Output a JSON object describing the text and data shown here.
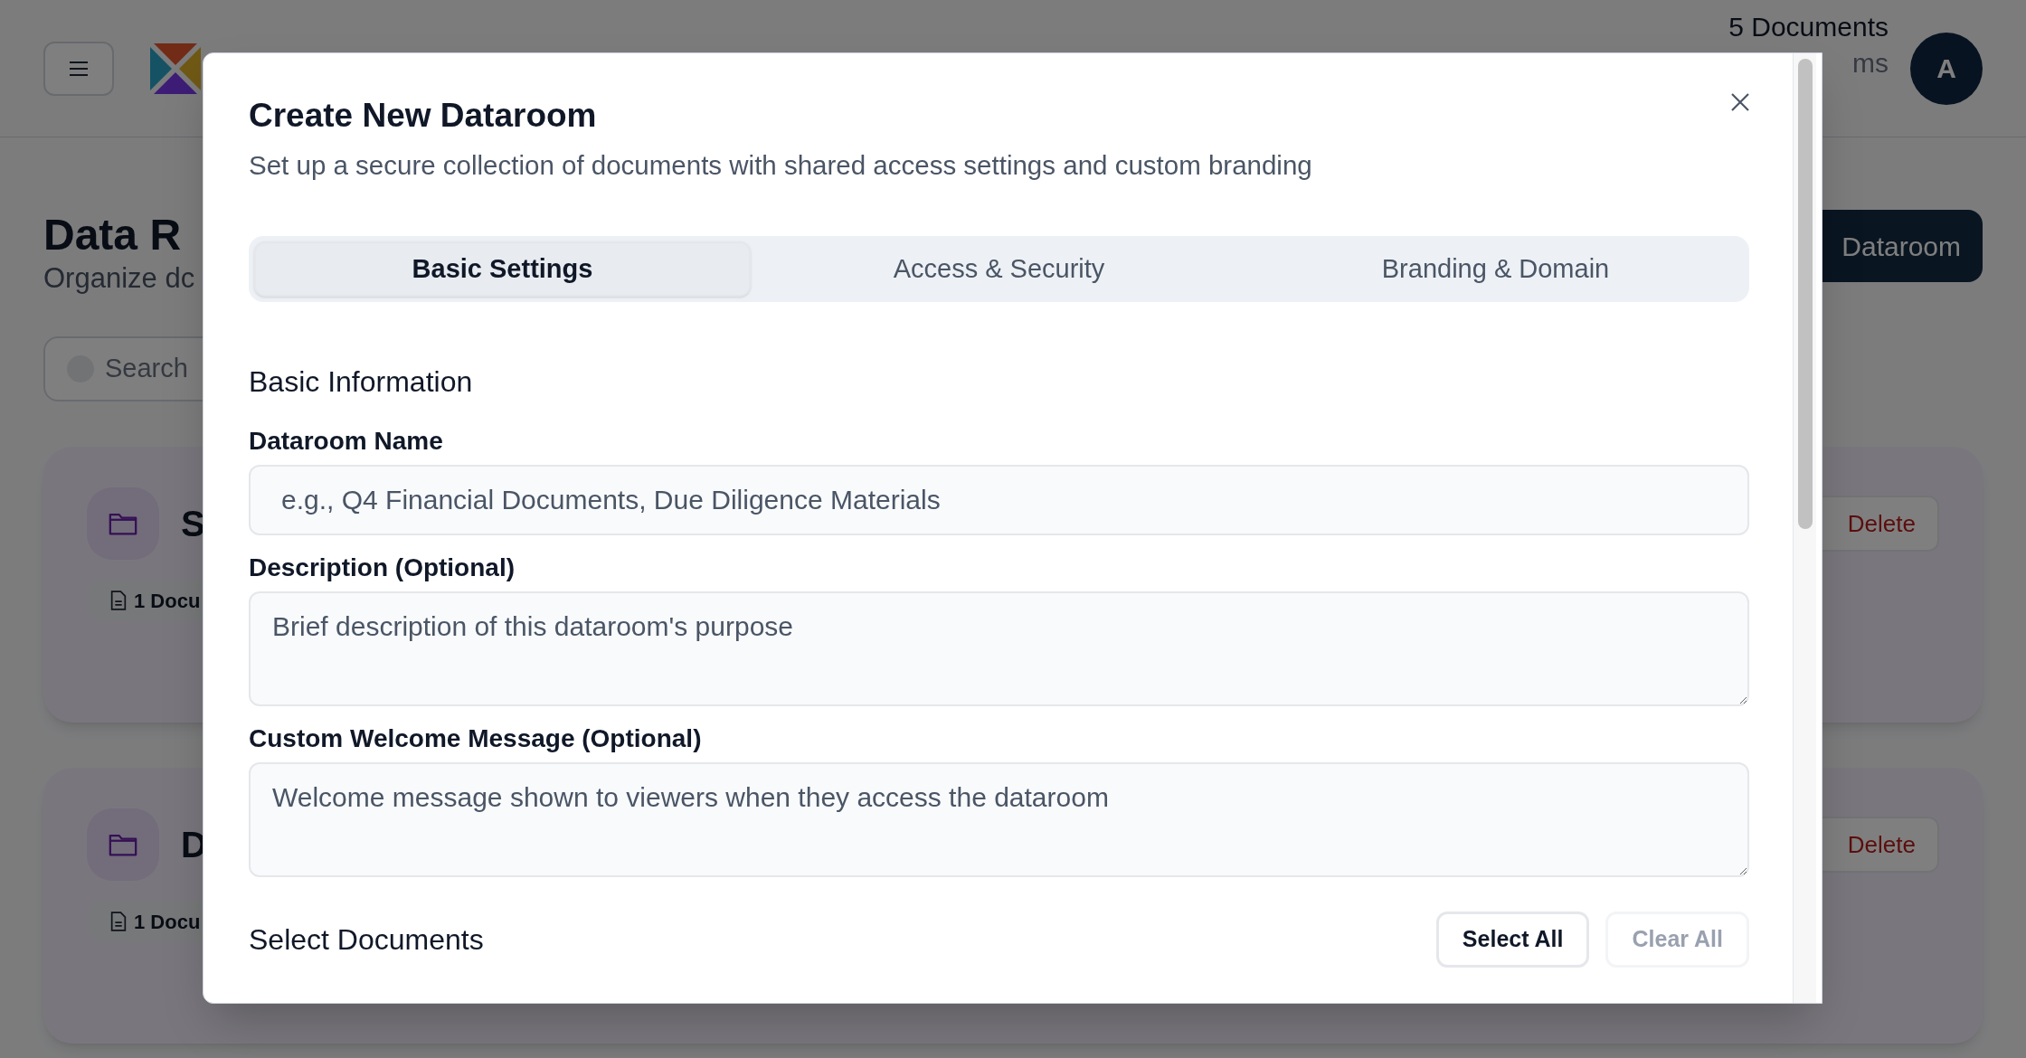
{
  "background": {
    "header_stats": [
      "5 Documents",
      "ms"
    ],
    "avatar": "A",
    "page_title": "Data R",
    "page_subtitle": "Organize dc",
    "search": {
      "placeholder": "Search"
    },
    "new_button": "Dataroom",
    "cards": [
      {
        "initial": "S",
        "count": "1 Docu",
        "delete": "Delete"
      },
      {
        "initial": "D",
        "count": "1 Docu",
        "delete": "Delete"
      }
    ]
  },
  "dialog": {
    "title": "Create New Dataroom",
    "subtitle": "Set up a secure collection of documents with shared access settings and custom branding",
    "tabs": [
      {
        "label": "Basic Settings",
        "selected": true
      },
      {
        "label": "Access & Security",
        "selected": false
      },
      {
        "label": "Branding & Domain",
        "selected": false
      }
    ],
    "section": "Basic Information",
    "fields": [
      {
        "kind": "input",
        "label": "Dataroom Name",
        "placeholder": "e.g., Q4 Financial Documents, Due Diligence Materials"
      },
      {
        "kind": "textarea",
        "label": "Description (Optional)",
        "placeholder": "Brief description of this dataroom's purpose"
      },
      {
        "kind": "textarea",
        "label": "Custom Welcome Message (Optional)",
        "placeholder": "Welcome message shown to viewers when they access the dataroom"
      }
    ],
    "documents": {
      "title": "Select Documents",
      "buttons": [
        {
          "label": "Select All",
          "disabled": false
        },
        {
          "label": "Clear All",
          "disabled": true
        }
      ]
    }
  }
}
